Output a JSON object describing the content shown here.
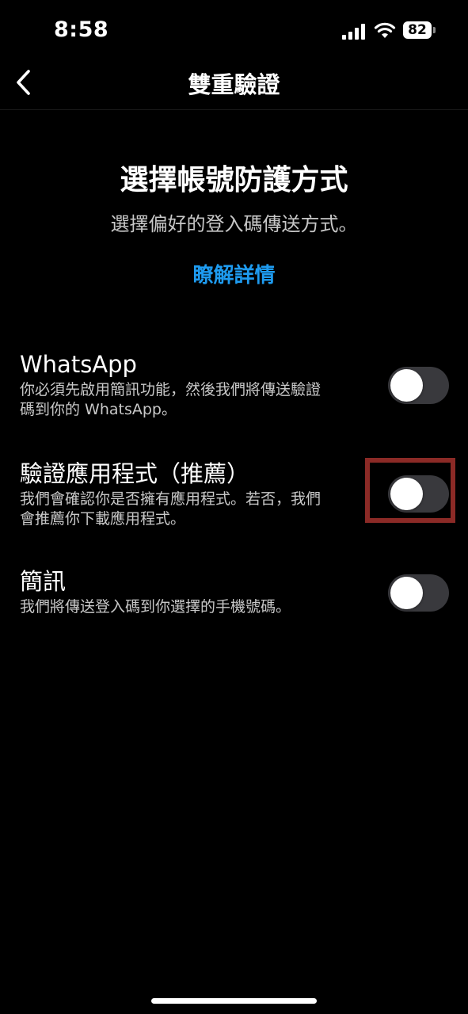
{
  "status_bar": {
    "time": "8:58",
    "battery": "82"
  },
  "nav": {
    "title": "雙重驗證"
  },
  "main": {
    "heading": "選擇帳號防護方式",
    "subtitle": "選擇偏好的登入碼傳送方式。",
    "learn_more": "瞭解詳情",
    "link_color": "#1e9bf0"
  },
  "options": [
    {
      "title": "WhatsApp",
      "desc_line1": "你必須先啟用簡訊功能，然後我們將傳送驗證",
      "desc_line2": "碼到你的 WhatsApp。",
      "enabled": false
    },
    {
      "title": "驗證應用程式（推薦）",
      "desc_line1": "我們會確認你是否擁有應用程式。若否，我們",
      "desc_line2": "會推薦你下載應用程式。",
      "enabled": false
    },
    {
      "title": "簡訊",
      "desc_line1": "我們將傳送登入碼到你選擇的手機號碼。",
      "enabled": false
    }
  ],
  "colors": {
    "background": "#000000",
    "toggle_off": "#39393d",
    "highlight_box": "#8b2a26"
  }
}
